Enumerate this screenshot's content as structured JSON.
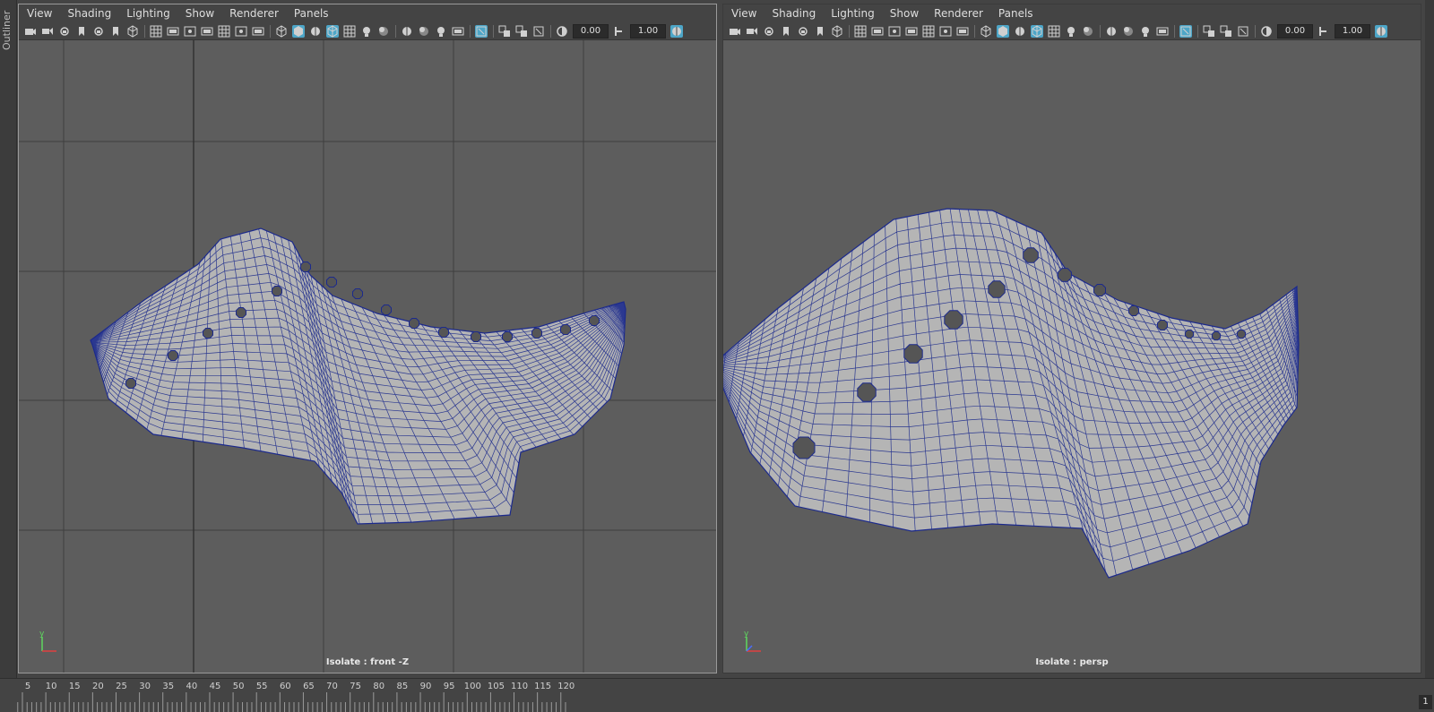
{
  "outliner": {
    "label": "Outliner"
  },
  "menus": [
    "View",
    "Shading",
    "Lighting",
    "Show",
    "Renderer",
    "Panels"
  ],
  "toolbar": {
    "exposure_value": "0.00",
    "gamma_value": "1.00"
  },
  "left_viewport": {
    "camera_label": "Isolate : front -Z"
  },
  "right_viewport": {
    "camera_label": "Isolate : persp"
  },
  "axis": {
    "y": "y"
  },
  "timeline": {
    "ticks": [
      "5",
      "10",
      "15",
      "20",
      "25",
      "30",
      "35",
      "40",
      "45",
      "50",
      "55",
      "60",
      "65",
      "70",
      "75",
      "80",
      "85",
      "90",
      "95",
      "100",
      "105",
      "110",
      "115",
      "120"
    ],
    "current_frame": "1"
  },
  "icons": [
    "camera-icon",
    "select-camera-icon",
    "lock-camera-icon",
    "bookmark-icon",
    "grid-icon",
    "film-gate-icon",
    "resolution-gate-icon",
    "wireframe-icon",
    "smooth-shade-icon",
    "textured-icon",
    "lights-icon",
    "shadows-icon",
    "isolate-select-icon",
    "xray-icon",
    "exposure-icon",
    "gamma-icon"
  ],
  "colors": {
    "viewport_bg": "#5d5d5d",
    "mesh_fill": "#b5b5b5",
    "mesh_wire": "#1c2a8c",
    "active_icon": "#4da6c8"
  }
}
